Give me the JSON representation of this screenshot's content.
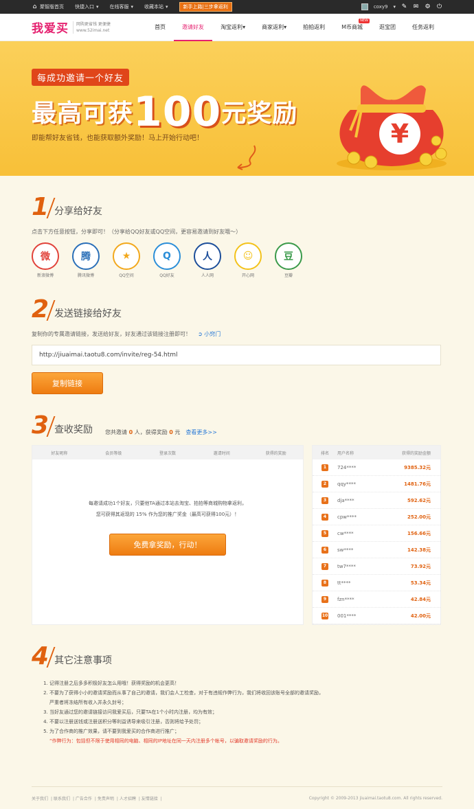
{
  "topbar": {
    "left": [
      "聚智版首页",
      "快捷入口",
      "在线客服",
      "收藏本站"
    ],
    "promo": "新手上路|三步拿返利",
    "user": "coxy9"
  },
  "nav": {
    "logo": "我爱买",
    "logo_sub1": "网购更省钱  更便捷",
    "logo_sub2": "www.52imai.net",
    "menu": [
      "首页",
      "邀请好友",
      "淘宝返利",
      "商家返利",
      "拍拍返利",
      "M币商城",
      "逛宝团",
      "任务返利"
    ],
    "new_badge": "NEW"
  },
  "banner": {
    "tag": "每成功邀请一个好友",
    "big_prefix": "最高可获",
    "big_num": "100",
    "big_suffix": "元奖励",
    "sub": "即能帮好友省钱，也能获取额外奖励！马上开始行动吧！",
    "yen": "¥"
  },
  "step1": {
    "num": "1",
    "title": "分享给好友",
    "desc": "点击下方任意按钮，分享即可！（分享给QQ好友或QQ空间，更容易邀请到好友哦～）",
    "shares": [
      {
        "label": "新浪微博",
        "glyph": "微",
        "color": "#e1423a",
        "icon": "weibo-icon"
      },
      {
        "label": "腾讯微博",
        "glyph": "腾",
        "color": "#2a6fb8",
        "icon": "tencent-weibo-icon"
      },
      {
        "label": "QQ空间",
        "glyph": "★",
        "color": "#f2a81c",
        "icon": "qzone-icon"
      },
      {
        "label": "QQ好友",
        "glyph": "Q",
        "color": "#2b8ed8",
        "icon": "qq-icon"
      },
      {
        "label": "人人网",
        "glyph": "人",
        "color": "#1c4e9a",
        "icon": "renren-icon"
      },
      {
        "label": "开心网",
        "glyph": "☺",
        "color": "#f3c21a",
        "icon": "kaixin-icon"
      },
      {
        "label": "豆瓣",
        "glyph": "豆",
        "color": "#3a9a4a",
        "icon": "douban-icon"
      }
    ]
  },
  "step2": {
    "num": "2",
    "title": "发送链接给好友",
    "desc": "复制你的专属邀请链接，发送给好友，好友通过该链接注册即可！",
    "tip": "小窍门",
    "link": "http://jiuaimai.taotu8.com/invite/reg-54.html",
    "copy_btn": "复制链接"
  },
  "step3": {
    "num": "3",
    "title": "查收奖励",
    "stat_prefix": "您共邀请",
    "invited": "0",
    "stat_mid": "人，获得奖励",
    "reward": "0",
    "stat_unit": "元",
    "more": "查看更多>>",
    "left_headers": [
      "好友昵称",
      "会员等级",
      "登录次数",
      "邀请时间",
      "获得的奖励"
    ],
    "empty_line1": "每邀请成功1个好友，只要他TA通过本站去淘宝、拍拍等商城购物拿返利，",
    "empty_line2": "您可获得其返现的 15% 作为您的推广奖金（最高可获得100元）！",
    "go_btn": "免费拿奖励，行动！",
    "right_headers": [
      "排名",
      "用户名称",
      "获得的奖励金额"
    ],
    "ranking": [
      {
        "rank": "1",
        "name": "724****",
        "amount": "9385.32元"
      },
      {
        "rank": "2",
        "name": "qqy****",
        "amount": "1481.76元"
      },
      {
        "rank": "3",
        "name": "dja****",
        "amount": "592.62元"
      },
      {
        "rank": "4",
        "name": "cpw****",
        "amount": "252.00元"
      },
      {
        "rank": "5",
        "name": "cw****",
        "amount": "156.66元"
      },
      {
        "rank": "6",
        "name": "sw****",
        "amount": "142.38元"
      },
      {
        "rank": "7",
        "name": "tw7****",
        "amount": "73.92元"
      },
      {
        "rank": "8",
        "name": "tt****",
        "amount": "53.34元"
      },
      {
        "rank": "9",
        "name": "fzn****",
        "amount": "42.84元"
      },
      {
        "rank": "10",
        "name": "001****",
        "amount": "42.00元"
      }
    ]
  },
  "step4": {
    "num": "4",
    "title": "其它注意事项",
    "notes": [
      "记得注册之后多多积极好友怎么用哦！获得奖励的机会更高！",
      "不要为了获得小小的邀请奖励而从事了自己的邀请，我们会人工检查，对于有违规作弊行为，我们将收回该账号全部的邀请奖励，",
      "严重者将冻结所有收入并永久封号；",
      "当好友通过您的邀请链接访问我爱买后，只要TA在1个小时内注册，均为有效；",
      "不要以注册送钱或注册送积分等利益诱导来吸引注册，否则将给予处罚；",
      "为了合作商的推广效果，请不要到我爱买的合作商进行推广；"
    ],
    "warning": "“作弊行为：包括但不限于使用相同的电脑、相同的IP地址在同一天内注册多个帐号，以骗取邀请奖励的行为。"
  },
  "footer": {
    "links": [
      "关于我们",
      "联系我们",
      "广告合作",
      "免责声明",
      "人才招聘",
      "友情链接"
    ],
    "copyright": "Copyright © 2009-2013 jiuaimai.taotu8.com. All rights reserved."
  }
}
